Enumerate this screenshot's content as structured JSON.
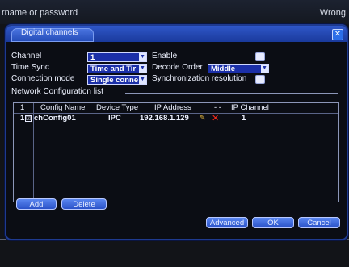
{
  "background": {
    "left_text": "rname or password",
    "right_text": "Wrong"
  },
  "dialog": {
    "title": "Digital channels",
    "close_symbol": "✕"
  },
  "form": {
    "channel_label": "Channel",
    "channel_value": "1",
    "enable_label": "Enable",
    "enable_checked": false,
    "time_sync_label": "Time Sync",
    "time_sync_value": "Time and Tir",
    "decode_order_label": "Decode Order",
    "decode_order_value": "Middle",
    "connection_mode_label": "Connection mode",
    "connection_mode_value": "Single conne",
    "sync_resolution_label": "Synchronization resolution",
    "sync_resolution_checked": false
  },
  "network_list": {
    "title": "Network Configuration list",
    "columns": {
      "index": "1",
      "config_name": "Config Name",
      "device_type": "Device Type",
      "ip_address": "IP Address",
      "dashes": "- -",
      "ip_channel": "IP Channel"
    },
    "rows": [
      {
        "index": "1",
        "checked": true,
        "check_symbol": "☑",
        "config_name": "chConfig01",
        "device_type": "IPC",
        "ip_address": "192.168.1.129",
        "ip_channel": "1"
      }
    ]
  },
  "buttons": {
    "add": "Add",
    "delete": "Delete",
    "advanced": "Advanced",
    "ok": "OK",
    "cancel": "Cancel"
  },
  "colors": {
    "accent": "#2f57c8",
    "select_bg": "#1b2fa8",
    "delete_icon": "#ff2a1a",
    "edit_icon": "#f0c040"
  }
}
